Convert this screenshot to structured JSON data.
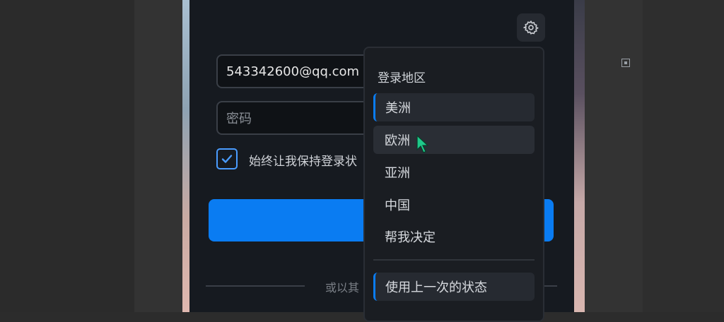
{
  "login": {
    "email_value": "543342600@qq.com",
    "password_placeholder": "密码",
    "remember_label": "始终让我保持登录状",
    "or_text": "或以其"
  },
  "region_menu": {
    "title": "登录地区",
    "items": [
      {
        "label": "美洲",
        "state": "selected"
      },
      {
        "label": "欧洲",
        "state": "hover"
      },
      {
        "label": "亚洲",
        "state": "normal"
      },
      {
        "label": "中国",
        "state": "normal"
      },
      {
        "label": "帮我决定",
        "state": "normal"
      }
    ],
    "last_state_label": "使用上一次的状态"
  },
  "icons": {
    "settings": "gear-icon",
    "checkbox": "check-icon",
    "cursor": "mouse-cursor-icon",
    "corner": "small-square-icon"
  },
  "colors": {
    "accent": "#0a7cf2",
    "panel_bg": "#161a20",
    "menu_bg": "#1a1d22"
  }
}
